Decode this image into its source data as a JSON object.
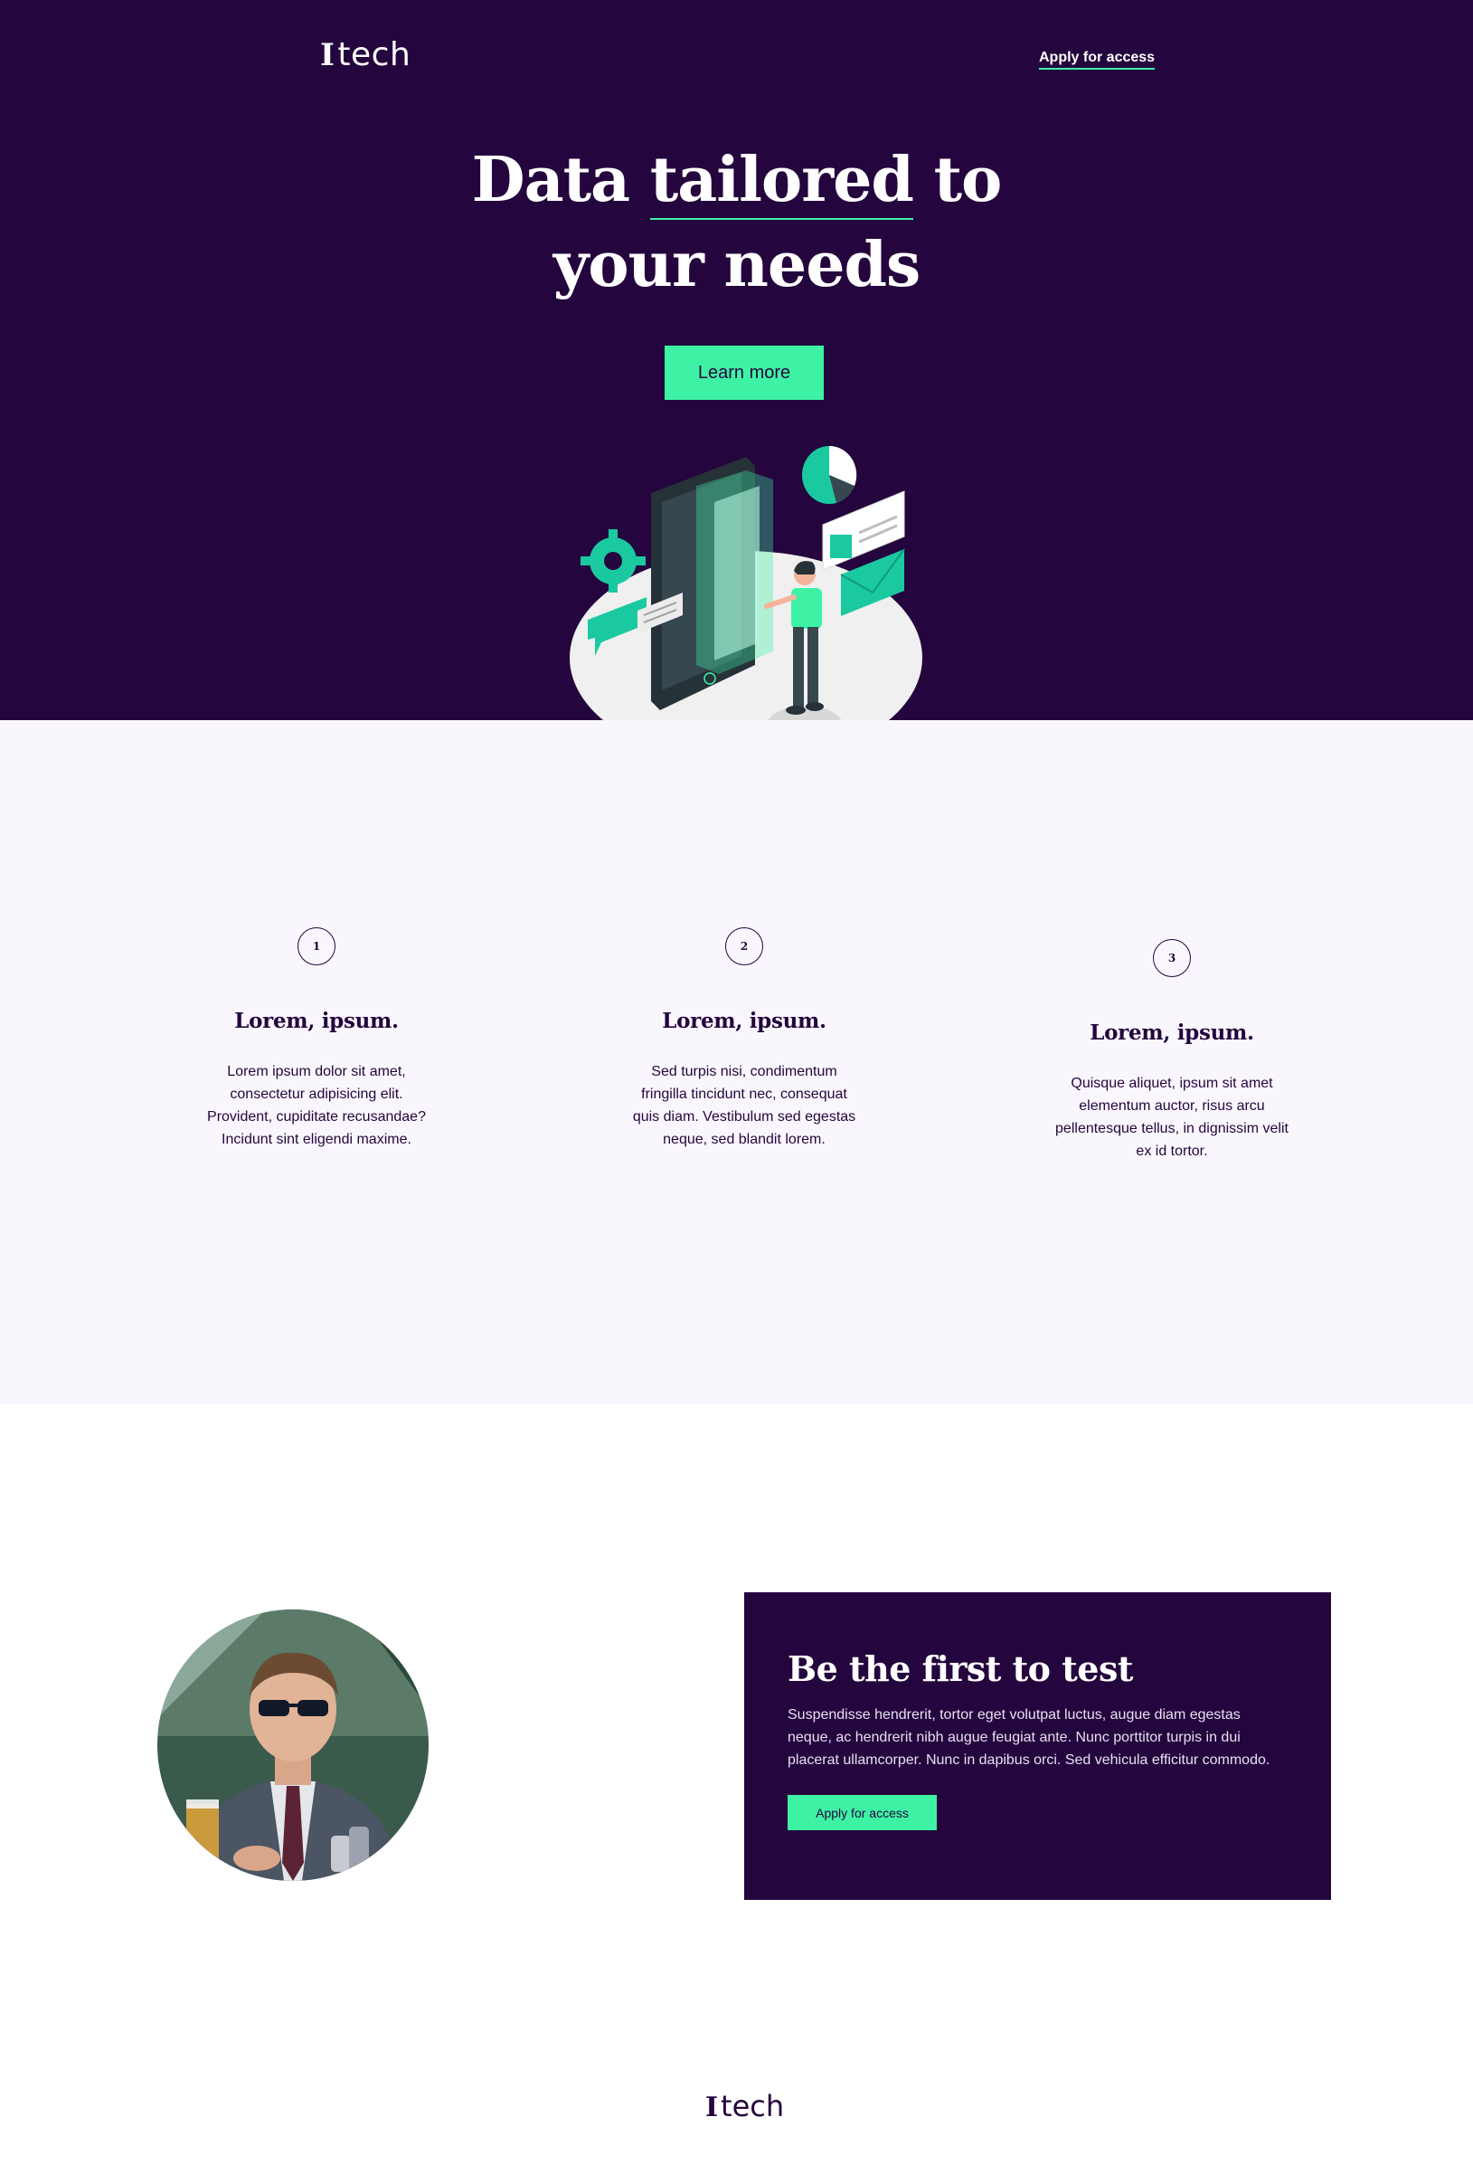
{
  "brand": {
    "mark": "I",
    "name": "tech"
  },
  "nav": {
    "apply_label": "Apply for access"
  },
  "hero": {
    "title_pre": "Data ",
    "title_underlined": "tailored",
    "title_post": " to",
    "title_line2": "your needs",
    "cta_label": "Learn more"
  },
  "features": [
    {
      "number": "1",
      "title": "Lorem, ipsum.",
      "text": "Lorem ipsum dolor sit amet, consectetur adipisicing elit. Provident, cupiditate recusandae? Incidunt sint eligendi maxime."
    },
    {
      "number": "2",
      "title": "Lorem, ipsum.",
      "text": "Sed turpis nisi, condimentum fringilla tincidunt nec, consequat quis diam. Vestibulum sed egestas neque, sed blandit lorem."
    },
    {
      "number": "3",
      "title": "Lorem, ipsum.",
      "text": "Quisque aliquet, ipsum sit amet elementum auctor, risus arcu pellentesque tellus, in dignissim velit ex id tortor."
    }
  ],
  "cta": {
    "title": "Be the first to test",
    "text": "Suspendisse hendrerit, tortor eget volutpat luctus, augue diam egestas neque, ac hendrerit nibh augue feugiat ante. Nunc porttitor turpis in dui placerat ullamcorper. Nunc in dapibus orci. Sed vehicula efficitur commodo.",
    "button_label": "Apply for access"
  },
  "colors": {
    "primary": "#24053d",
    "accent": "#3ef2a5",
    "light_bg": "#f9f7fd"
  },
  "icons": {
    "illustration": "phone-analytics-illustration",
    "avatar": "person-photo"
  }
}
